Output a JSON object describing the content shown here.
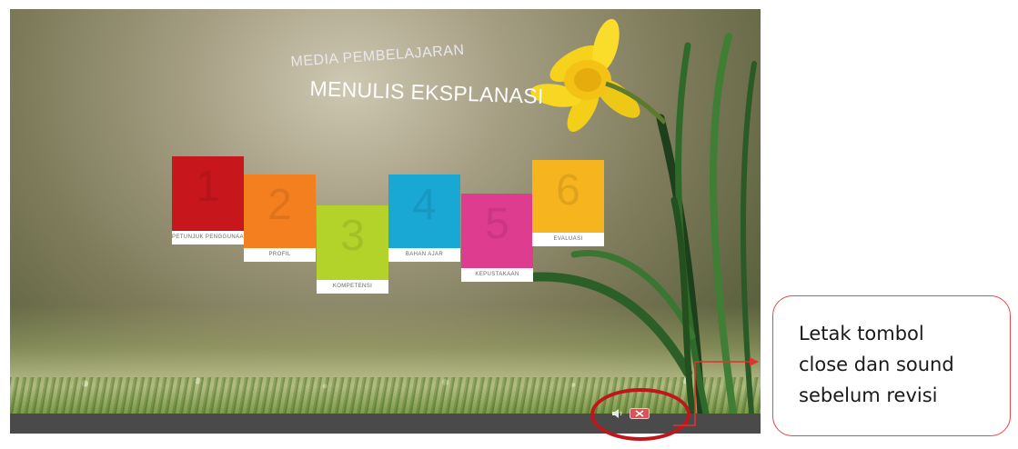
{
  "app": {
    "subtitle": "MEDIA PEMBELAJARAN",
    "title": "MENULIS EKSPLANASI"
  },
  "menu": [
    {
      "number": "1",
      "label": "PETUNJUK PENGGUNAAN",
      "color": "#c8161d"
    },
    {
      "number": "2",
      "label": "PROFIL",
      "color": "#f47f1f"
    },
    {
      "number": "3",
      "label": "KOMPETENSI",
      "color": "#b3d22a"
    },
    {
      "number": "4",
      "label": "BAHAN AJAR",
      "color": "#19a8d3"
    },
    {
      "number": "5",
      "label": "KEPUSTAKAAN",
      "color": "#dd3c8f"
    },
    {
      "number": "6",
      "label": "EVALUASI",
      "color": "#f6b41e"
    }
  ],
  "controls": {
    "sound_icon": "speaker-icon",
    "close_icon": "close-icon"
  },
  "annotation": {
    "lines": [
      "Letak tombol",
      "close dan sound",
      "sebelum revisi"
    ],
    "color": "#c0161b"
  }
}
